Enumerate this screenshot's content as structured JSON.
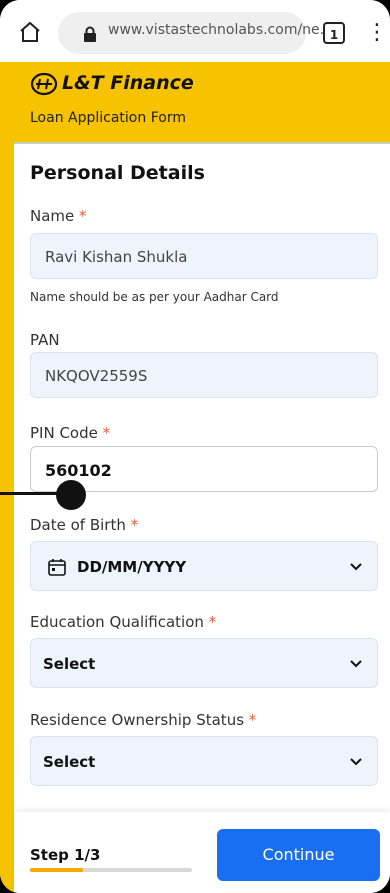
{
  "browser": {
    "url": "www.vistastechnolabs.com/ne.",
    "tab_count": "1",
    "more_icon": "more-vert-icon"
  },
  "brand": {
    "name": "L&T Finance",
    "subtitle": "Loan Application Form",
    "color": "#f7c300"
  },
  "form": {
    "section_title": "Personal Details",
    "name_label": "Name",
    "name_value": "Ravi Kishan Shukla",
    "name_hint": "Name should be as per your Aadhar Card",
    "pan_label": "PAN",
    "pan_value": "NKQOV2559S",
    "pin_label": "PIN Code",
    "pin_value": "560102",
    "dob_label": "Date of Birth",
    "dob_placeholder": "DD/MM/YYYY",
    "education_label": "Education Qualification",
    "education_value": "Select",
    "residence_label": "Residence Ownership Status",
    "residence_value": "Select",
    "required_marker": "*"
  },
  "footer": {
    "step_text": "Step 1/3",
    "progress_fraction": 0.33,
    "continue_label": "Continue",
    "button_color": "#1a6ef1"
  }
}
